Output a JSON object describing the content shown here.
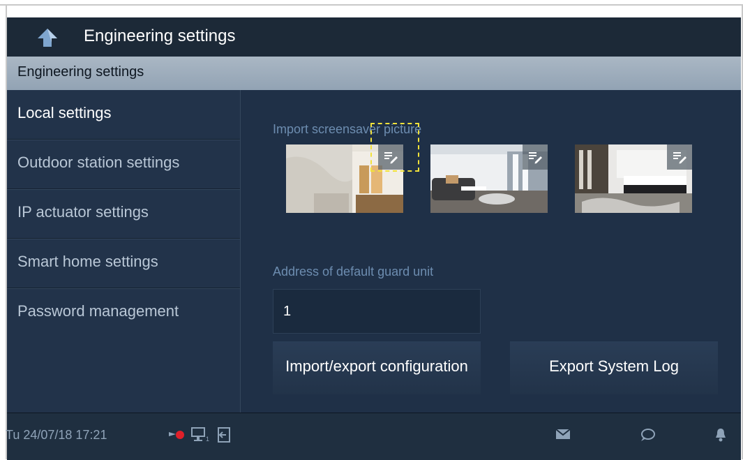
{
  "header": {
    "title": "Engineering settings"
  },
  "section": {
    "title": "Engineering settings"
  },
  "sidebar": {
    "items": [
      {
        "label": "Local settings"
      },
      {
        "label": "Outdoor station settings"
      },
      {
        "label": "IP actuator settings"
      },
      {
        "label": "Smart home settings"
      },
      {
        "label": "Password management"
      }
    ]
  },
  "main": {
    "screensaver_label": "Import screensaver picture",
    "guard_label": "Address of default guard unit",
    "guard_value": "1",
    "import_export_label": "Import/export configuration",
    "export_log_label": "Export System Log"
  },
  "status": {
    "datetime": "Tu 24/07/18  17:21",
    "icons": [
      "camera-record-icon",
      "monitor-icon",
      "door-exit-icon",
      "mail-icon",
      "chat-icon",
      "bell-icon"
    ]
  },
  "colors": {
    "background": "#1f3047",
    "header_bar": "#9fb0c1",
    "label_blue": "#6d8db0",
    "highlight_dash": "#f2e23a",
    "record_dot": "#e0202a"
  }
}
